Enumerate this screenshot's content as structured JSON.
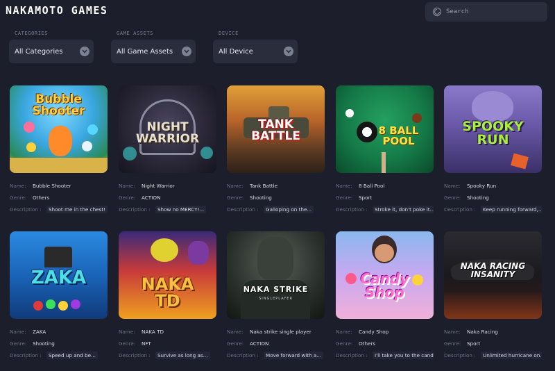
{
  "header": {
    "logo": "NAKAMOTO GAMES",
    "search_placeholder": "Search"
  },
  "filters": [
    {
      "label": "CATEGORIES",
      "value": "All Categories"
    },
    {
      "label": "GAME ASSETS",
      "value": "All Game Assets"
    },
    {
      "label": "DEVICE",
      "value": "All Device"
    }
  ],
  "field_labels": {
    "name": "Name:",
    "genre": "Genre:",
    "description": "Description :"
  },
  "games": [
    {
      "name": "Bubble Shooter",
      "genre": "Others",
      "description": "Shoot me in the chest!",
      "art_title": "Bubble Shooter"
    },
    {
      "name": "Night Warrior",
      "genre": "ACTION",
      "description": "Show no MERCY!...",
      "art_title": "NIGHT WARRIOR"
    },
    {
      "name": "Tank Battle",
      "genre": "Shooting",
      "description": "Galloping on the...",
      "art_title": "TANK BATTLE"
    },
    {
      "name": "8 Ball Pool",
      "genre": "Sport",
      "description": "Stroke it, don't poke it....",
      "art_title": "8 BALL POOL"
    },
    {
      "name": "Spooky Run",
      "genre": "Shooting",
      "description": "Keep running forward,...",
      "art_title": "SPOOKY RUN"
    },
    {
      "name": "ZAKA",
      "genre": "Shooting",
      "description": "Speed up and be...",
      "art_title": "ZAKA"
    },
    {
      "name": "NAKA TD",
      "genre": "NFT",
      "description": "Survive as long as...",
      "art_title": "NAKA TD"
    },
    {
      "name": "Naka strike single player",
      "genre": "ACTION",
      "description": "Move forward with a...",
      "art_title": "NAKA STRIKE"
    },
    {
      "name": "Candy Shop",
      "genre": "Others",
      "description": "I'll take you to the cand...",
      "art_title": "Candy Shop"
    },
    {
      "name": "Naka Racing",
      "genre": "Sport",
      "description": "Unlimited hurricane on...",
      "art_title": "NAKA RACING INSANITY"
    }
  ]
}
